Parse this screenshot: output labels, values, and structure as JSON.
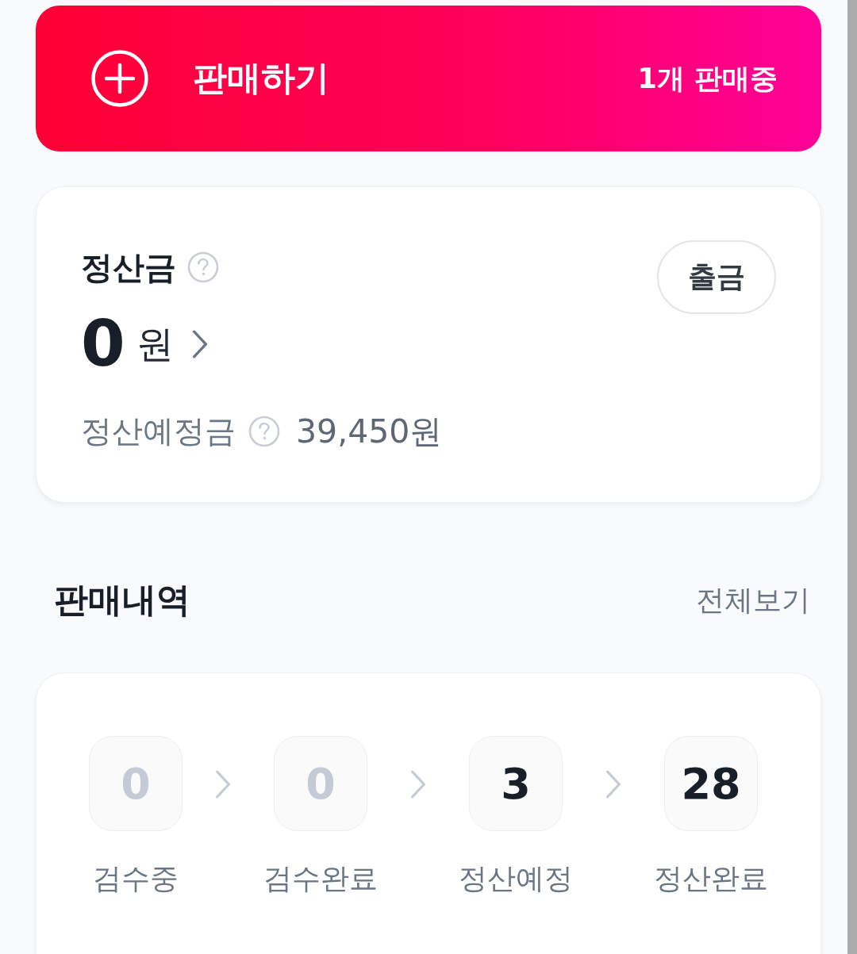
{
  "sell_banner": {
    "label": "판매하기",
    "status": "1개 판매중"
  },
  "settlement": {
    "title": "정산금",
    "amount": "0",
    "unit": "원",
    "withdraw_button": "출금",
    "pending_label": "정산예정금",
    "pending_amount": "39,450원"
  },
  "sales_history": {
    "title": "판매내역",
    "view_all": "전체보기",
    "stages": [
      {
        "count": "0",
        "label": "검수중",
        "dimmed": true
      },
      {
        "count": "0",
        "label": "검수완료",
        "dimmed": true
      },
      {
        "count": "3",
        "label": "정산예정",
        "dimmed": false
      },
      {
        "count": "28",
        "label": "정산완료",
        "dimmed": false
      }
    ]
  }
}
